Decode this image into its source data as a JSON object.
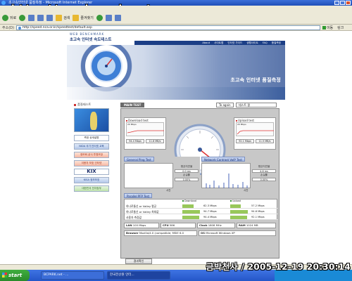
{
  "window": {
    "title": "초고속인터넷 품질측정 - Microsoft Internet Explorer",
    "watermark": "http://www.bcpark.net"
  },
  "toolbar": {
    "back_label": "뒤로",
    "search_label": "검색",
    "favorites_label": "즐겨찾기"
  },
  "address": {
    "label": "주소(D)",
    "url": "http://speed.nca.or.kr/speedtest/default.asp",
    "go_label": "이동",
    "links_label": "링크"
  },
  "site": {
    "logo_small": "WEB BENCHMARK",
    "logo_title": "초고속 인터넷 속도테스트",
    "nav": [
      "About",
      "사이트맵",
      "인터넷 가이드",
      "생활사이트",
      "FAQ",
      "품질측정"
    ],
    "banner_title": "초고속 인터넷 품질측정"
  },
  "sidebar": {
    "heading": "품질테스트",
    "items": [
      {
        "label": "측정 상세설명"
      },
      {
        "label": "NIDA 국가 인터넷 교육",
        "style": "blue"
      },
      {
        "label": "정보화 공식 투명보장",
        "style": "red"
      },
      {
        "label": "이용자 보호 인터넷",
        "style": "red"
      },
      {
        "label": "KIX",
        "style": "kix"
      },
      {
        "label": "KISA 정보보호",
        "style": "blue"
      },
      {
        "label": "대한민국 전자정부",
        "style": "green"
      }
    ]
  },
  "speedtest": {
    "tab_main": "MAIN TEST",
    "retry_label": "To again",
    "dropdown_value": "테스트 결",
    "download": {
      "title": "Download test",
      "unit_label": "20 Mbps",
      "mbps": "94.4 Mbps",
      "mbytes": "11.8 MB/s"
    },
    "upload": {
      "title": "Upload test",
      "unit_label": "20 Mbps",
      "mbps": "92.1 Mbps",
      "mbytes": "11.5 MB/s"
    },
    "ping_test": {
      "head": "General Ping Test",
      "axis_label": "시간",
      "avg_latency_label": "평균지연율",
      "avg_latency_value": "0.0 ms",
      "loss_label": "손실률",
      "loss_value": "0.00%"
    },
    "voip_test": {
      "head": "Network Contrast VoIP Test",
      "axis_label": "시간",
      "avg_latency_label": "평균지연율",
      "avg_latency_value": "4.6 ms",
      "loss_label": "손실률",
      "loss_value": "0.00%"
    },
    "pfp_head": "Parallel PFP Test",
    "results": {
      "download_head": "Download",
      "upload_head": "Upload",
      "rows": [
        {
          "label": "하나로통신 or Valley 평균",
          "down": "62.3 Mbps",
          "up": "57.2 Mbps",
          "down_level": 0.62,
          "up_level": 0.57
        },
        {
          "label": "하나로통신 or Valley 최대값",
          "down": "94.7 Mbps",
          "up": "94.6 Mbps",
          "down_level": 0.95,
          "up_level": 0.95
        },
        {
          "label": "사용자 측정값",
          "down": "94.4 Mbps",
          "up": "92.1 Mbps",
          "down_level": 0.94,
          "up_level": 0.92
        }
      ]
    },
    "specs": {
      "lan_label": "LAN",
      "lan_value": "100 Mbps",
      "cpu_label": "CPU",
      "cpu_value": "586",
      "clock_label": "Clock",
      "clock_value": "1808 MHz",
      "ram_label": "RAM",
      "ram_value": "1024 MB",
      "browser_label": "Browser",
      "browser_value": "Mozilla/4.0 (compatible; MSIE 6.0",
      "os_label": "OS",
      "os_value": "Microsoft Windows XP"
    },
    "close_label": "결과확인"
  },
  "taskbar": {
    "start_label": "start",
    "tasks": [
      "BCPARK.net - ...",
      "한국전산원 인터..."
    ]
  },
  "timestamp": "금박천사 / 2005-12-19 20:30:14",
  "colors": {
    "accent": "#1b3e86",
    "bar_fill": "#98c85a",
    "gauge_ring": "#6f8fbf"
  }
}
